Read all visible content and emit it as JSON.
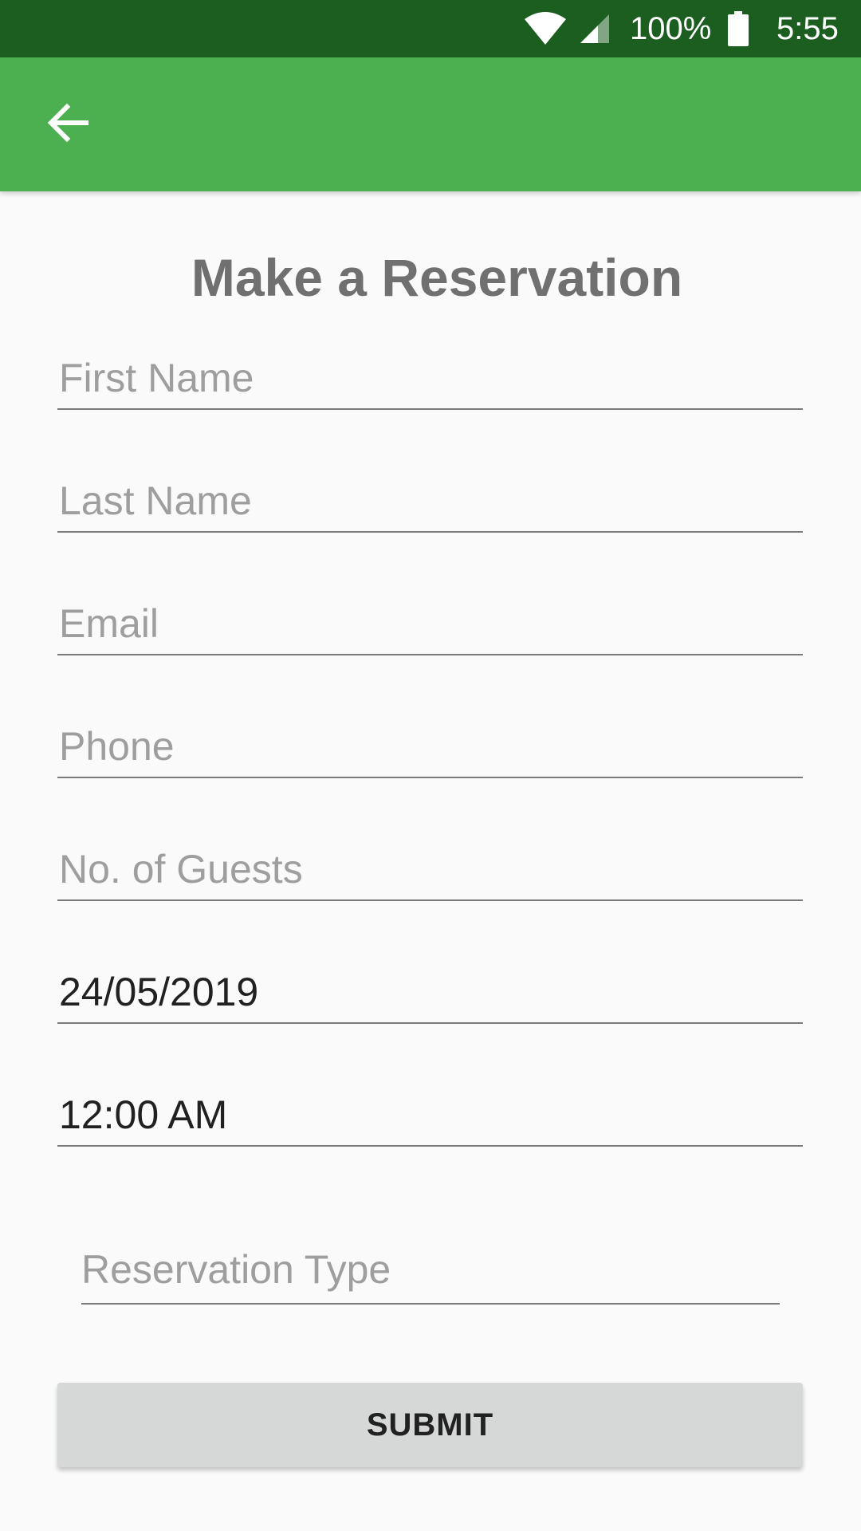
{
  "status_bar": {
    "battery_percent": "100%",
    "time": "5:55",
    "icons": [
      "wifi-icon",
      "cell-signal-icon",
      "battery-icon"
    ],
    "color": "#1b5e20"
  },
  "app_bar": {
    "back_icon": "arrow-back-icon",
    "color": "#4caf50"
  },
  "form": {
    "title": "Make a Reservation",
    "fields": {
      "first_name": {
        "placeholder": "First Name",
        "value": ""
      },
      "last_name": {
        "placeholder": "Last Name",
        "value": ""
      },
      "email": {
        "placeholder": "Email",
        "value": ""
      },
      "phone": {
        "placeholder": "Phone",
        "value": ""
      },
      "guests": {
        "placeholder": "No. of Guests",
        "value": ""
      },
      "date": {
        "value": "24/05/2019"
      },
      "time": {
        "value": "12:00 AM"
      }
    },
    "reservation_type": {
      "placeholder": "Reservation Type"
    },
    "submit_label": "SUBMIT"
  }
}
